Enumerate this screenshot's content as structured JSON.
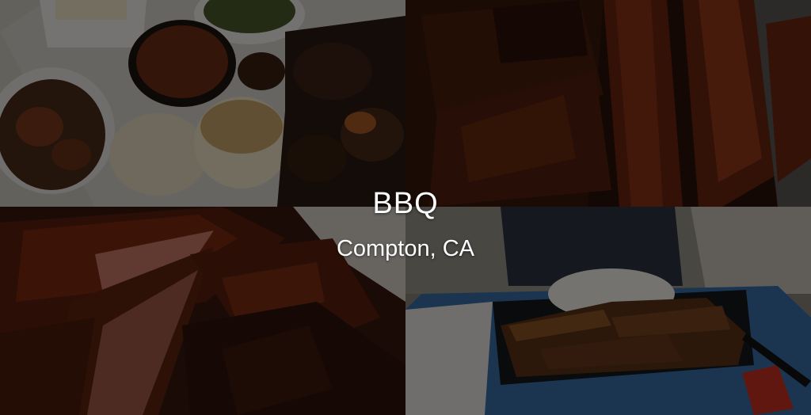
{
  "banner": {
    "title": "BBQ",
    "subtitle": "Compton, CA"
  },
  "photos": [
    {
      "depicts": "platter-with-burnt-ends-rolls-sides"
    },
    {
      "depicts": "glazed-ribs-and-sausages"
    },
    {
      "depicts": "smoked-ribs-closeup"
    },
    {
      "depicts": "rice-plate-with-grilled-meat-on-tray"
    }
  ],
  "colors": {
    "overlay": "#000000",
    "caption_text": "#ffffff",
    "tray_blue": "#3a6fa8"
  }
}
